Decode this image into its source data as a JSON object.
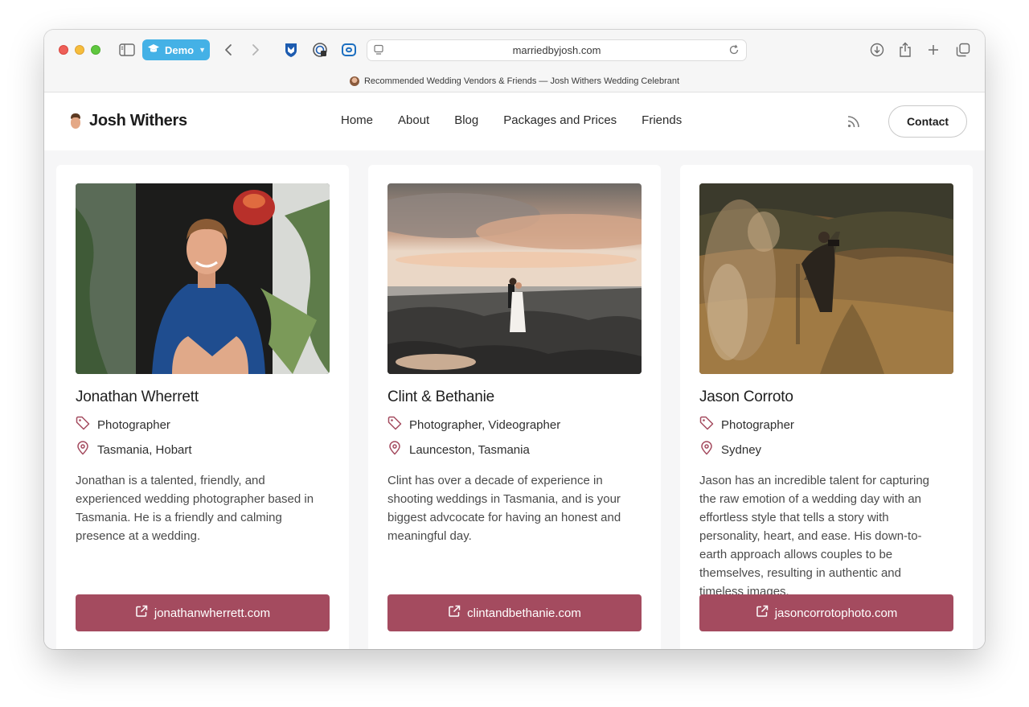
{
  "browser": {
    "demo_label": "Demo",
    "url": "marriedbyjosh.com",
    "tab_title": "Recommended Wedding Vendors & Friends — Josh Withers Wedding Celebrant"
  },
  "site": {
    "logo": "Josh Withers",
    "nav": [
      "Home",
      "About",
      "Blog",
      "Packages and Prices",
      "Friends"
    ],
    "contact_label": "Contact"
  },
  "vendors": [
    {
      "name": "Jonathan Wherrett",
      "role": "Photographer",
      "location": "Tasmania, Hobart",
      "description": "Jonathan is a talented, friendly, and experienced wedding photographer based in Tasmania. He is a friendly and calming presence at a wedding.",
      "website": "jonathanwherrett.com"
    },
    {
      "name": "Clint & Bethanie",
      "role": "Photographer, Videographer",
      "location": "Launceston, Tasmania",
      "description": "Clint has over a decade of experience in shooting weddings in Tasmania, and is your biggest advcocate for having an honest and meaningful day.",
      "website": "clintandbethanie.com"
    },
    {
      "name": "Jason Corroto",
      "role": "Photographer",
      "location": "Sydney",
      "description": "Jason has an incredible talent for capturing the raw emotion of a wedding day with an effortless style that tells a story with personality, heart, and ease. His down-to-earth approach allows couples to be themselves, resulting in authentic and timeless images.",
      "website": "jasoncorrotophoto.com"
    }
  ],
  "colors": {
    "accent": "#a44b5f",
    "icon_accent": "#a44b5f",
    "safari_blue": "#44b1e6"
  }
}
